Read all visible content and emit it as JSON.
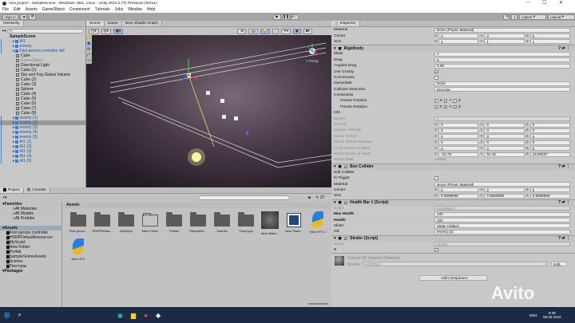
{
  "window": {
    "title": "new project - SampleScene - Windows, Mac, Linux - Unity 2021.2.7f1 Personal <DX11>",
    "controls": [
      "–",
      "☐",
      "✕"
    ]
  },
  "menu": [
    "File",
    "Edit",
    "Assets",
    "GameObject",
    "Component",
    "Tutorials",
    "Jobs",
    "Window",
    "Help"
  ],
  "toolbar": {
    "sign_in": "Sign in",
    "layers": "Layers",
    "layout": "Layout"
  },
  "hierarchy": {
    "tab": "Hierarchy",
    "search_placeholder": "All",
    "scene": "SampleScene",
    "items": [
      {
        "label": "AI1",
        "type": "prefab"
      },
      {
        "label": "enemy",
        "type": "prefab"
      },
      {
        "label": "First person controller full",
        "type": "prefab"
      },
      {
        "label": "Cube",
        "type": "obj"
      },
      {
        "label": "GameObject",
        "type": "disabled"
      },
      {
        "label": "Directional Light",
        "type": "obj"
      },
      {
        "label": "Cube (1)",
        "type": "obj"
      },
      {
        "label": "Sky and Fog Global Volume",
        "type": "obj"
      },
      {
        "label": "Cube (2)",
        "type": "obj"
      },
      {
        "label": "Cube (3)",
        "type": "obj"
      },
      {
        "label": "Sphere",
        "type": "obj"
      },
      {
        "label": "Cube (4)",
        "type": "obj"
      },
      {
        "label": "Cube (5)",
        "type": "obj"
      },
      {
        "label": "Cube (6)",
        "type": "obj"
      },
      {
        "label": "Cube (7)",
        "type": "obj"
      },
      {
        "label": "Cube (8)",
        "type": "obj"
      },
      {
        "label": "enemy (1)",
        "type": "prefab"
      },
      {
        "label": "enemy (2)",
        "type": "prefab",
        "selected": true
      },
      {
        "label": "enemy (3)",
        "type": "prefab"
      },
      {
        "label": "enemy (4)",
        "type": "prefab"
      },
      {
        "label": "enemy (5)",
        "type": "prefab"
      },
      {
        "label": "AI1 (1)",
        "type": "prefab"
      },
      {
        "label": "AI1 (2)",
        "type": "prefab"
      },
      {
        "label": "AI1 (3)",
        "type": "prefab"
      },
      {
        "label": "AI1 (4)",
        "type": "prefab"
      },
      {
        "label": "AI1 (5)",
        "type": "prefab"
      }
    ]
  },
  "scene": {
    "tabs": [
      "Scene",
      "Game",
      "New Shader Graph"
    ],
    "toggle_2d": "2D",
    "gizmo_label": "< Persp"
  },
  "inspector": {
    "tab": "Inspector",
    "top_rows": [
      {
        "label": "Material",
        "value": "None (Physic Material)"
      },
      {
        "label": "Center",
        "vec": [
          "0",
          "0",
          "0"
        ]
      },
      {
        "label": "Size",
        "vec": [
          "1",
          "1",
          "1"
        ]
      }
    ],
    "rigidbody": {
      "title": "Rigidbody",
      "rows": [
        {
          "label": "Mass",
          "value": "1"
        },
        {
          "label": "Drag",
          "value": "0"
        },
        {
          "label": "Angular Drag",
          "value": "0.05"
        },
        {
          "label": "Use Gravity",
          "check": true
        },
        {
          "label": "Is Kinematic",
          "check": false
        },
        {
          "label": "Interpolate",
          "value": "None"
        },
        {
          "label": "Collision Detection",
          "value": "Discrete"
        }
      ],
      "constraints": "Constraints",
      "freeze_pos": "Freeze Position",
      "freeze_rot": "Freeze Rotation",
      "axes": [
        "X",
        "Y",
        "Z"
      ],
      "info": "Info",
      "info_rows": [
        {
          "label": "Speed",
          "value": "0"
        },
        {
          "label": "Velocity",
          "vec": [
            "0",
            "0",
            "0"
          ]
        },
        {
          "label": "Angular Velocity",
          "vec": [
            "0",
            "0",
            "0"
          ]
        },
        {
          "label": "Inertia Tensor",
          "vec": [
            "0",
            "0",
            "0"
          ]
        },
        {
          "label": "Inertia Tensor Rotation",
          "vec": [
            "0",
            "0",
            "0"
          ]
        },
        {
          "label": "Local Center of Mass",
          "vec": [
            "0",
            "0",
            "0"
          ]
        },
        {
          "label": "World Center of Mass",
          "vec": [
            "-22.75",
            "64.18",
            "18.80537"
          ]
        },
        {
          "label": "Sleep State",
          "text": "Awake"
        }
      ]
    },
    "box_collider": {
      "title": "Box Collider",
      "rows": [
        {
          "label": "Edit Collider",
          "text": ""
        },
        {
          "label": "Is Trigger",
          "check": false
        },
        {
          "label": "Material",
          "value": "None (Physic Material)"
        },
        {
          "label": "Center",
          "vec": [
            "0",
            "0",
            "0"
          ]
        },
        {
          "label": "Size",
          "vec": [
            "0.9999999",
            "0.9999999",
            "0.9999999"
          ]
        }
      ]
    },
    "health_bar": {
      "title": "Health Bar 1 (Script)",
      "rows": [
        {
          "label": "Script",
          "value": "HealthBar1",
          "dis": true
        },
        {
          "label": "Max Health",
          "value": "100",
          "bold": true
        },
        {
          "label": "Health",
          "value": "100",
          "bold": true
        },
        {
          "label": "Slider",
          "value": "Slider (Slider)"
        },
        {
          "label": "HB",
          "value": "enemy (2)"
        }
      ]
    },
    "strafer": {
      "title": "Strafer (Script)",
      "rows": [
        {
          "label": "Script",
          "value": "Strafer",
          "dis": true
        },
        {
          "label": "B",
          "check": true
        }
      ]
    },
    "material": {
      "name": "Default HD Material (Material)",
      "shader_label": "Shader",
      "shader": "HDRP/Lit",
      "edit": "Edit..."
    },
    "add_component": "Add Component"
  },
  "project": {
    "tabs": [
      "Project",
      "Console"
    ],
    "count": "27",
    "tree": [
      {
        "label": "Favorites",
        "hdr": true
      },
      {
        "label": "All Materials",
        "ind": 2
      },
      {
        "label": "All Models",
        "ind": 2
      },
      {
        "label": "All Prefabs",
        "ind": 2
      },
      {
        "label": "",
        "ind": 0
      },
      {
        "label": "Assets",
        "hdr": true,
        "sel": true
      },
      {
        "label": "First person controller",
        "ind": 1
      },
      {
        "label": "HDRPDefaultResources",
        "ind": 1
      },
      {
        "label": "MyScript",
        "ind": 1
      },
      {
        "label": "New Folder",
        "ind": 1
      },
      {
        "label": "Prefab",
        "ind": 1
      },
      {
        "label": "SampleSceneAssets",
        "ind": 1
      },
      {
        "label": "Scenes",
        "ind": 1
      },
      {
        "label": "Текстуры",
        "ind": 1
      },
      {
        "label": "Packages",
        "hdr": true
      }
    ],
    "breadcrumb": "Assets",
    "assets": [
      {
        "label": "First perso...",
        "kind": "folder"
      },
      {
        "label": "HDRPDefau...",
        "kind": "folder"
      },
      {
        "label": "MyScript",
        "kind": "folder"
      },
      {
        "label": "New Folder",
        "kind": "empty"
      },
      {
        "label": "Prefab",
        "kind": "folder"
      },
      {
        "label": "SampleSc...",
        "kind": "folder"
      },
      {
        "label": "Scenes",
        "kind": "folder"
      },
      {
        "label": "Текстуры",
        "kind": "folder"
      },
      {
        "label": "New Mater...",
        "kind": "material"
      },
      {
        "label": "New Shad...",
        "kind": "shader"
      },
      {
        "label": "New VFX 1",
        "kind": "vfx"
      },
      {
        "label": "New VFX",
        "kind": "vfx"
      }
    ]
  },
  "taskbar": {
    "lang": "ENG",
    "time": "9:38",
    "date": "06.05.2022"
  },
  "watermark": "Avito"
}
